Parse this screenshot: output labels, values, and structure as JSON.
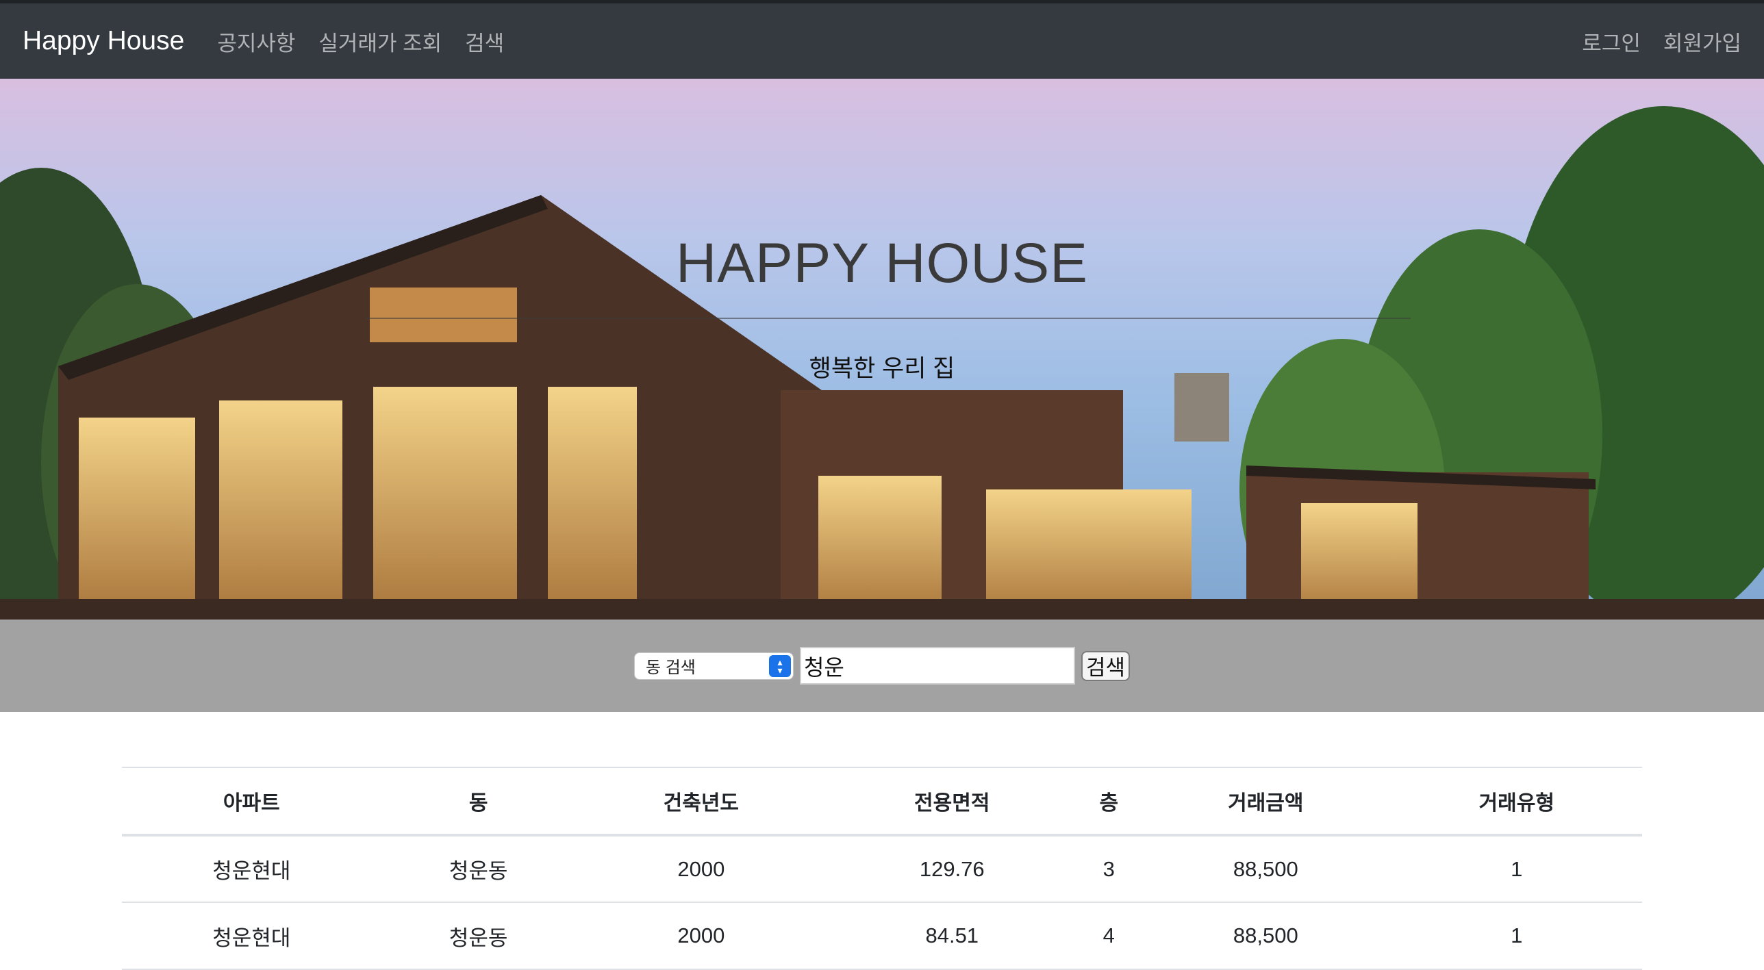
{
  "navbar": {
    "brand": "Happy House",
    "links": [
      "공지사항",
      "실거래가 조회",
      "검색"
    ],
    "right_links": [
      "로그인",
      "회원가입"
    ]
  },
  "hero": {
    "title": "HAPPY HOUSE",
    "subtitle": "행복한 우리 집"
  },
  "search": {
    "select_value": "동 검색",
    "input_value": "청운",
    "button_label": "검색"
  },
  "table": {
    "headers": [
      "아파트",
      "동",
      "건축년도",
      "전용면적",
      "층",
      "거래금액",
      "거래유형"
    ],
    "rows": [
      [
        "청운현대",
        "청운동",
        "2000",
        "129.76",
        "3",
        "88,500",
        "1"
      ],
      [
        "청운현대",
        "청운동",
        "2000",
        "84.51",
        "4",
        "88,500",
        "1"
      ]
    ]
  },
  "colors": {
    "navbar_bg": "#343a40",
    "search_band_bg": "#a2a2a2",
    "select_accent": "#1a73e8"
  }
}
